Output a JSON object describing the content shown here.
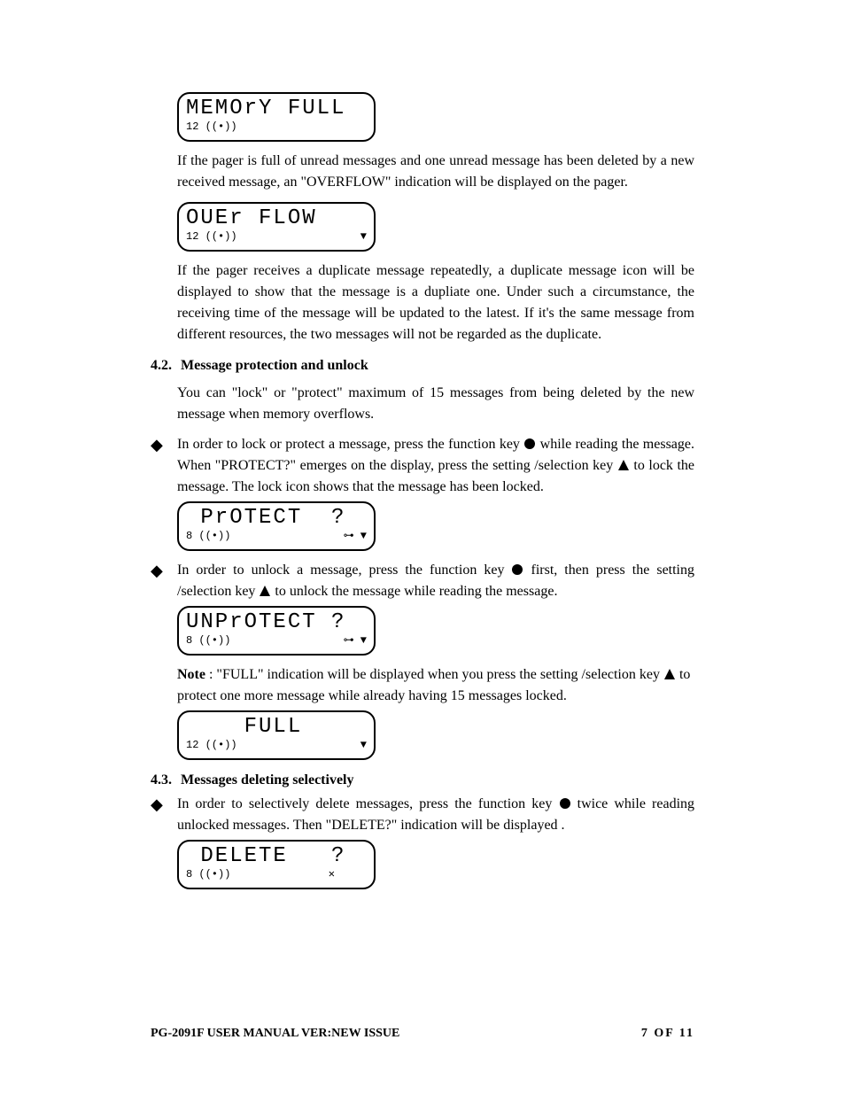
{
  "lcd1": {
    "main": "MEMOrY FULL",
    "sub_left": "12 ((•))",
    "sub_right": ""
  },
  "para1": "If the pager is full of unread messages and one unread message has been deleted by a new received message, an \"OVERFLOW\" indication will be displayed on the pager.",
  "lcd2": {
    "main": "OUEr FLOW",
    "sub_left": "12 ((•))",
    "sub_right": "▼"
  },
  "para2": "If the pager receives a duplicate message repeatedly, a duplicate message icon will be displayed to show that the message is a dupliate one. Under such a circumstance, the receiving time of the message will be updated to the latest. If it's the same message from different resources, the two messages will not be regarded as the duplicate.",
  "sec42_num": "4.2.",
  "sec42_title": "Message protection and unlock",
  "sec42_intro": "You can \"lock\" or \"protect\" maximum of 15 messages from being deleted by the new message when memory overflows.",
  "b1a": "In order to lock or protect a message, press the function key ",
  "b1b": " while reading the message. When \"PROTECT?\" emerges on the display, press the setting /selection key ",
  "b1c": " to lock the message. The lock icon shows that the message has been locked.",
  "lcd3": {
    "main": " PrOTECT  ?",
    "sub_left": "8 ((•))",
    "sub_right": "⊶ ▼"
  },
  "b2a": "In order to unlock a message, press the function key ",
  "b2b": " first, then press the setting /selection key ",
  "b2c": " to unlock the message while reading the message.",
  "lcd4": {
    "main": "UNPrOTECT ?",
    "sub_left": "8 ((•))",
    "sub_right": "⊶ ▼"
  },
  "note_label": "Note",
  "note_a": ": \"FULL\" indication will be displayed when you press the setting /selection key ",
  "note_b": "  to protect one more message while already having 15 messages locked.",
  "lcd5": {
    "main": "    FULL",
    "sub_left": "12 ((•))",
    "sub_right": "▼"
  },
  "sec43_num": "4.3.",
  "sec43_title": "Messages deleting selectively",
  "b3a": "In order to selectively delete messages, press the function key ",
  "b3b": " twice while reading unlocked messages. Then \"DELETE?\" indication will be displayed .",
  "lcd6": {
    "main": " DELETE   ?",
    "sub_left": "8 ((•))",
    "sub_right": "✕     "
  },
  "footer_left": "PG-2091F   USER MANUAL   VER:NEW ISSUE",
  "footer_page": "7",
  "footer_of": "OF",
  "footer_total": "11"
}
